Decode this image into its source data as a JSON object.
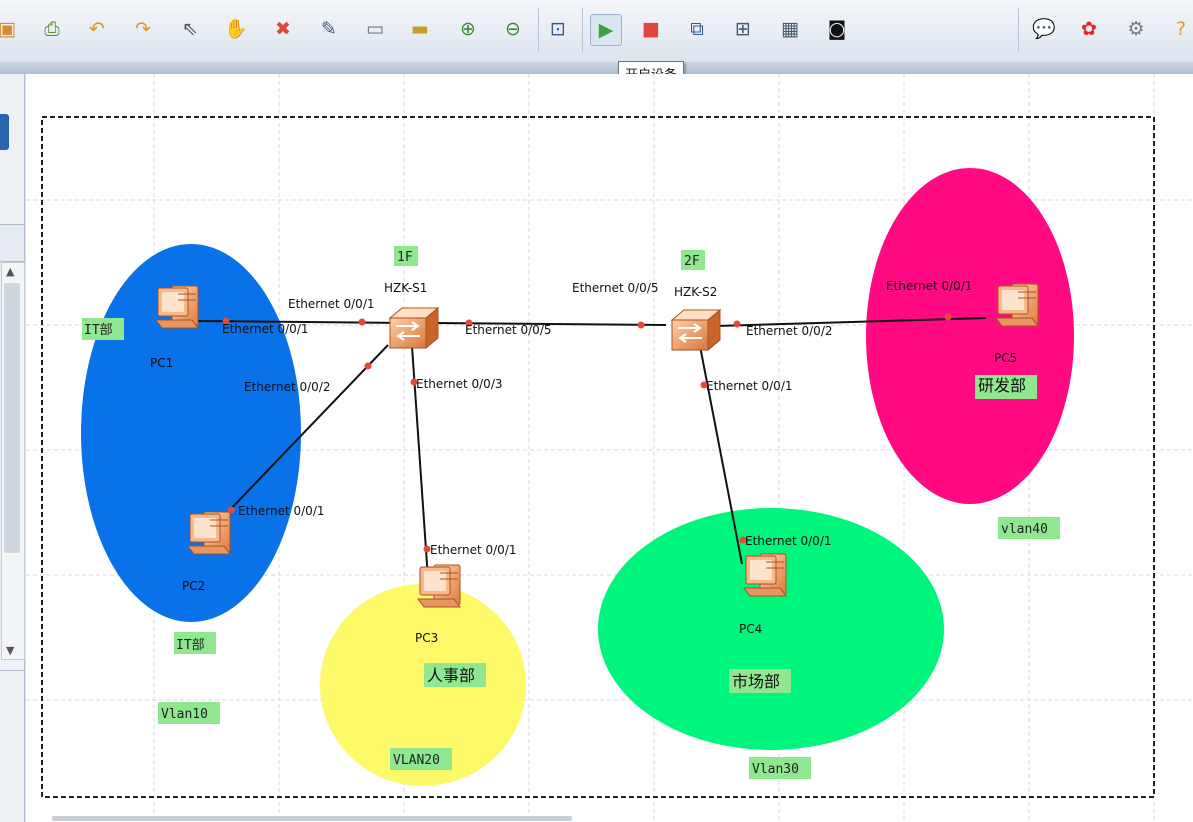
{
  "tooltip": "开启设备",
  "toolbar_icons": [
    "save-icon",
    "print-icon",
    "undo-icon",
    "redo-icon",
    "select-pointer-icon",
    "hand-pan-icon",
    "delete-icon",
    "erase-link-icon",
    "text-note-icon",
    "rectangle-icon",
    "zoom-in-icon",
    "zoom-out-icon",
    "fit-view-icon",
    "start-device-icon",
    "stop-device-icon",
    "capture-icon",
    "topology-icon",
    "grid-icon",
    "console-icon",
    "chat-icon",
    "huawei-logo-icon",
    "settings-icon",
    "help-icon"
  ],
  "devices": {
    "sw1": {
      "name": "HZK-S1",
      "floor": "1F"
    },
    "sw2": {
      "name": "HZK-S2",
      "floor": "2F"
    },
    "pc1": {
      "name": "PC1"
    },
    "pc2": {
      "name": "PC2"
    },
    "pc3": {
      "name": "PC3"
    },
    "pc4": {
      "name": "PC4"
    },
    "pc5": {
      "name": "PC5"
    }
  },
  "ports": {
    "s1_e1": "Ethernet 0/0/1",
    "pc1_e1": "Ethernet 0/0/1",
    "s1_e2": "Ethernet 0/0/2",
    "pc2_e1": "Ethernet 0/0/1",
    "s1_e3": "Ethernet 0/0/3",
    "pc3_e1": "Ethernet 0/0/1",
    "s1_e5": "Ethernet 0/0/5",
    "s2_e5": "Ethernet 0/0/5",
    "s2_e2": "Ethernet 0/0/2",
    "pc5_e1": "Ethernet 0/0/1",
    "s2_e1": "Ethernet 0/0/1",
    "pc4_e1": "Ethernet 0/0/1"
  },
  "dept_tags": {
    "it_top": "IT部",
    "it_bottom": "IT部",
    "hr": "人事部",
    "market": "市场部",
    "rd": "研发部"
  },
  "vlan_tags": {
    "v10": "Vlan10",
    "v20": "VLAN20",
    "v30": "Vlan30",
    "v40": "vlan40"
  },
  "colors": {
    "it_zone": "#0a72e8",
    "hr_zone": "#fdf969",
    "market_zone": "#00f57d",
    "rd_zone": "#ff0a82",
    "tag_bg": "#8fe88f",
    "port_dot": "#e8483a"
  }
}
